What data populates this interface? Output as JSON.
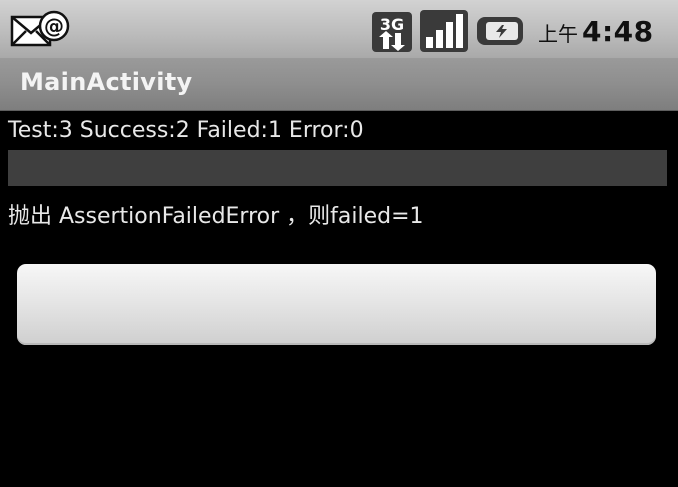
{
  "status_bar": {
    "left_icon": "email-notification-icon",
    "network_icon": "3g-data-icon",
    "network_label": "3G",
    "signal_icon": "signal-strength-icon",
    "battery_icon": "battery-charging-icon",
    "clock_ampm": "上午",
    "clock_time": "4:48"
  },
  "title_bar": {
    "title": "MainActivity"
  },
  "main": {
    "results_text": "Test:3 Success:2 Failed:1 Error:0",
    "progress_fraction": 0,
    "message_text": "抛出 AssertionFailedError ，则failed=1",
    "button_label": ""
  },
  "colors": {
    "background": "#000000",
    "status_bar": "#bdbdbd",
    "title_bar": "#8e8e8e",
    "progress_track": "#3f3f3f",
    "text": "#e8e8e8",
    "button": "#e6e6e6"
  }
}
